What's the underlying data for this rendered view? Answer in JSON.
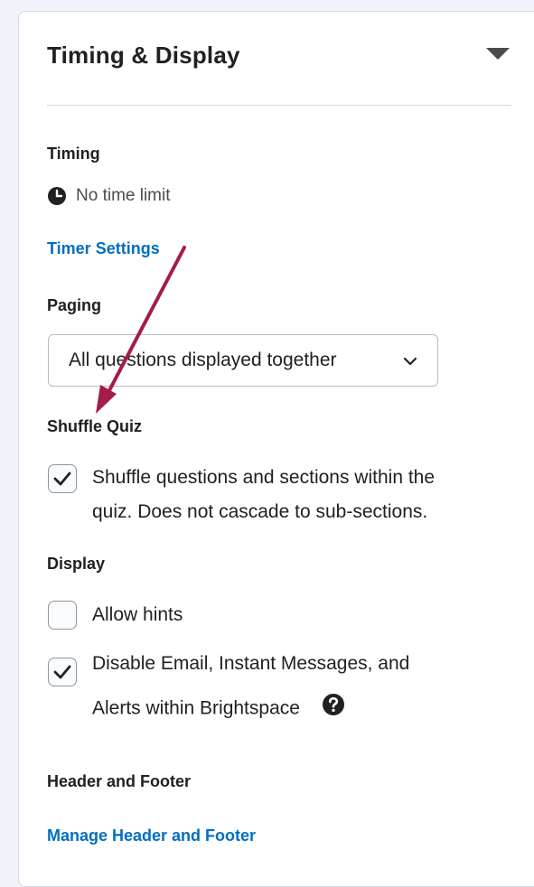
{
  "panel": {
    "title": "Timing & Display",
    "collapse_icon": "caret-down-icon"
  },
  "timing": {
    "label": "Timing",
    "status_icon": "clock-icon",
    "status_text": "No time limit",
    "settings_link": "Timer Settings"
  },
  "paging": {
    "label": "Paging",
    "selected": "All questions displayed together",
    "dropdown_icon": "chevron-down-icon"
  },
  "shuffle": {
    "label": "Shuffle Quiz",
    "option_line1": "Shuffle questions and sections within the",
    "option_line2": "quiz. Does not cascade to sub-sections.",
    "checked": true
  },
  "display": {
    "label": "Display",
    "allow_hints": "Allow hints",
    "allow_hints_checked": false,
    "disable_line1": "Disable Email, Instant Messages, and",
    "disable_line2": "Alerts within Brightspace",
    "disable_checked": true,
    "help_icon": "help-circle-icon"
  },
  "header_footer": {
    "label": "Header and Footer",
    "manage_link": "Manage Header and Footer"
  },
  "colors": {
    "link": "#006fbf",
    "annotation_arrow": "#a51c48",
    "text": "#202122"
  }
}
